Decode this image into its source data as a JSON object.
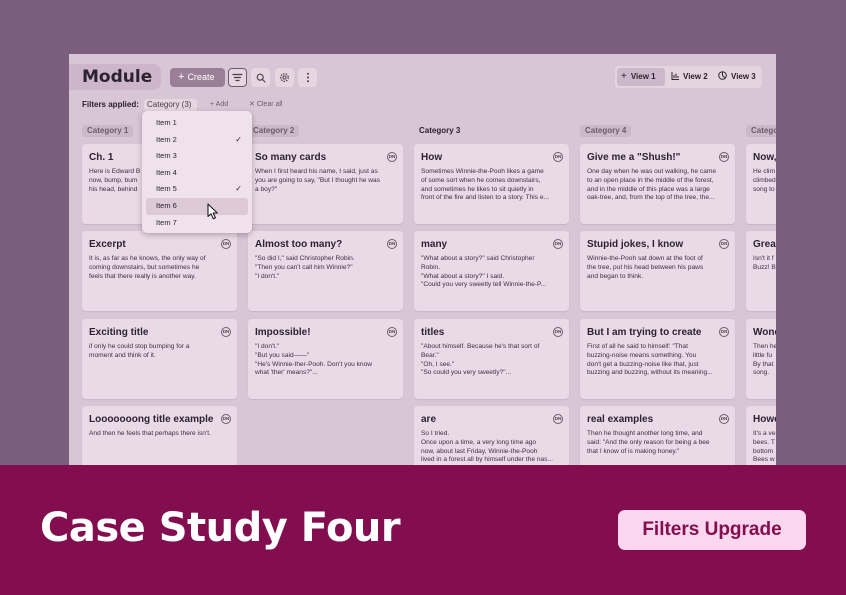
{
  "app": {
    "module_title": "Module",
    "create_label": "Create",
    "views": [
      "View 1",
      "View 2",
      "View 3"
    ]
  },
  "filters": {
    "label": "Filters applied:",
    "chip": "Category (3)",
    "add": "Add",
    "clear": "Clear all"
  },
  "dropdown": {
    "items": [
      "Item 1",
      "Item 2",
      "Item 3",
      "Item 4",
      "Item 5",
      "Item 6",
      "Item 7"
    ],
    "checked": [
      "Item 2",
      "Item 5"
    ],
    "highlighted": "Item 6"
  },
  "categories": [
    "Category 1",
    "Category 2",
    "Category 3",
    "Category 4",
    "Catego"
  ],
  "badge": "DN",
  "cards": {
    "c1": [
      {
        "title": "Ch. 1",
        "body": "Here is Edward B\nnow, bump, bum\nhis head, behind"
      },
      {
        "title": "Excerpt",
        "body": "It is, as far as he knows, the only way of\ncoming downstairs, but sometimes he\nfeels that there really is another way."
      },
      {
        "title": "Exciting title",
        "body": "if only he could stop bumping for a\nmoment and think of it."
      },
      {
        "title": "Looooooong title example",
        "body": "And then he feels that perhaps there isn't."
      }
    ],
    "c2": [
      {
        "title": "So many cards",
        "body": "When I first heard his name, I said, just as\nyou are going to say, \"But I thought he was\na boy?\""
      },
      {
        "title": "Almost too many?",
        "body": "\"So did I,\" said Christopher Robin.\n\"Then you can't call him Winnie?\"\n\"I don't.\""
      },
      {
        "title": "Impossible!",
        "body": "\"I don't.\"\n\"But you said——\"\n\"He's Winnie-ther-Pooh. Don't you know\nwhat 'ther' means?\"..."
      }
    ],
    "c3": [
      {
        "title": "How",
        "body": "Sometimes Winnie-the-Pooh likes a game\nof some sort when he comes downstairs,\nand sometimes he likes to sit quietly in\nfront of the fire and listen to a story. This e..."
      },
      {
        "title": "many",
        "body": "\"What about a story?\" said Christopher\nRobin.\n\"What about a story?\" I said.\n\"Could you very sweetly tell Winnie-the-P..."
      },
      {
        "title": "titles",
        "body": "\"About himself. Because he's that sort of\nBear.\"\n\"Oh, I see.\"\n\"So could you very sweetly?\"..."
      },
      {
        "title": "are",
        "body": "So I tried.\nOnce upon a time, a very long time ago\nnow, about last Friday, Winnie-the-Pooh\nlived in a forest all by himself under the nas..."
      }
    ],
    "c4": [
      {
        "title": "Give me a \"Shush!\"",
        "body": "One day when he was out walking, he came\nto an open place in the middle of the forest,\nand in the middle of this place was a large\noak-tree, and, from the top of the tree, the..."
      },
      {
        "title": "Stupid jokes, I know",
        "body": "Winnie-the-Pooh sat down at the foot of\nthe tree, put his head between his paws\nand began to think."
      },
      {
        "title": "But I am trying to create",
        "body": "First of all he said to himself: \"That\nbuzzing-noise means something. You\ndon't get a buzzing-noise like that, just\nbuzzing and buzzing, without its meaning..."
      },
      {
        "title": "real examples",
        "body": "Then he thought another long time, and\nsaid: \"And the only reason for being a bee\nthat I know of is making honey.\""
      }
    ],
    "c5": [
      {
        "title": "Now,",
        "body": "He clim\nclimbed\nsong to"
      },
      {
        "title": "Great",
        "body": "Isn't it f\nBuzz! B"
      },
      {
        "title": "Wond",
        "body": "Then he\nlittle fu\nBy that\nsong."
      },
      {
        "title": "Howe",
        "body": "It's a ve\nbees. T\nbottom\nBees w"
      }
    ]
  },
  "banner": {
    "title": "Case Study Four",
    "tag": "Filters Upgrade"
  },
  "colors": {
    "background": "#7b5e7e",
    "banner": "#830e4f",
    "pill": "#fbd6ef"
  }
}
